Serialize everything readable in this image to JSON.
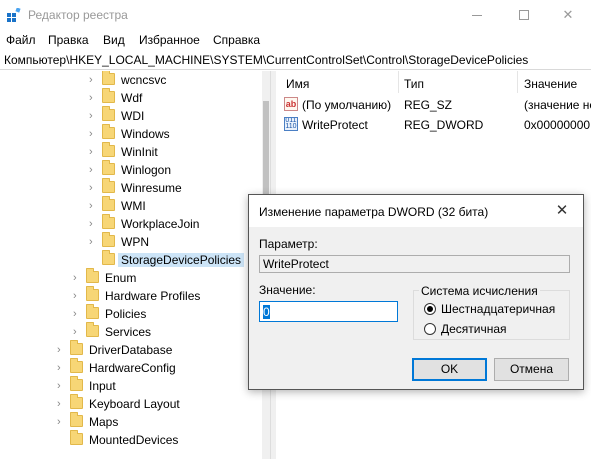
{
  "window": {
    "title": "Редактор реестра",
    "accent": "#0078d7"
  },
  "menu": [
    "Файл",
    "Правка",
    "Вид",
    "Избранное",
    "Справка"
  ],
  "address": "Компьютер\\HKEY_LOCAL_MACHINE\\SYSTEM\\CurrentControlSet\\Control\\StorageDevicePolicies",
  "tree": {
    "items": [
      {
        "label": "wcncsvc",
        "chevron": true
      },
      {
        "label": "Wdf",
        "chevron": true
      },
      {
        "label": "WDI",
        "chevron": true
      },
      {
        "label": "Windows",
        "chevron": true
      },
      {
        "label": "WinInit",
        "chevron": true
      },
      {
        "label": "Winlogon",
        "chevron": true
      },
      {
        "label": "Winresume",
        "chevron": true
      },
      {
        "label": "WMI",
        "chevron": true
      },
      {
        "label": "WorkplaceJoin",
        "chevron": true
      },
      {
        "label": "WPN",
        "chevron": true
      },
      {
        "label": "StorageDevicePolicies",
        "chevron": false
      },
      {
        "label": "Enum",
        "chevron": true
      },
      {
        "label": "Hardware Profiles",
        "chevron": true
      },
      {
        "label": "Policies",
        "chevron": true
      },
      {
        "label": "Services",
        "chevron": true
      },
      {
        "label": "DriverDatabase",
        "chevron": true
      },
      {
        "label": "HardwareConfig",
        "chevron": true
      },
      {
        "label": "Input",
        "chevron": true
      },
      {
        "label": "Keyboard Layout",
        "chevron": true
      },
      {
        "label": "Maps",
        "chevron": true
      },
      {
        "label": "MountedDevices",
        "chevron": false
      }
    ]
  },
  "list": {
    "headers": {
      "name": "Имя",
      "type": "Тип",
      "value": "Значение"
    },
    "rows": [
      {
        "icon": "string-value-icon",
        "icon_text": "ab",
        "name": "(По умолчанию)",
        "type": "REG_SZ",
        "value": "(значение не"
      },
      {
        "icon": "binary-value-icon",
        "icon_text": "011 110",
        "name": "WriteProtect",
        "type": "REG_DWORD",
        "value": "0x00000000 ("
      }
    ]
  },
  "dialog": {
    "title": "Изменение параметра DWORD (32 бита)",
    "param_label": "Параметр:",
    "param_value": "WriteProtect",
    "value_label": "Значение:",
    "value": "0",
    "base_group": "Система исчисления",
    "radio_hex": "Шестнадцатеричная",
    "radio_dec": "Десятичная",
    "ok": "OK",
    "cancel": "Отмена"
  }
}
